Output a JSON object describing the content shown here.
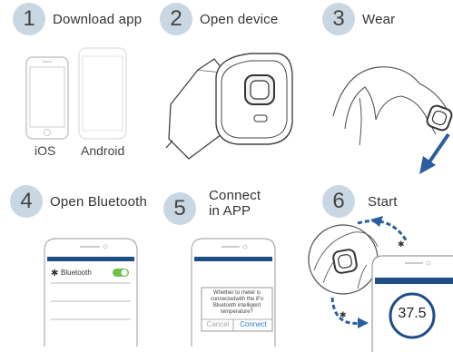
{
  "steps": [
    {
      "number": "1",
      "label": "Download app"
    },
    {
      "number": "2",
      "label": "Open device"
    },
    {
      "number": "3",
      "label": "Wear"
    },
    {
      "number": "4",
      "label": "Open Bluetooth"
    },
    {
      "number": "5",
      "label_line1": "Connect",
      "label_line2": "in APP"
    },
    {
      "number": "6",
      "label": "Start"
    }
  ],
  "download": {
    "ios": "iOS",
    "android": "Android"
  },
  "bluetooth_screen": {
    "setting_label": "Bluetooth"
  },
  "connect_dialog": {
    "line1": "Whether to meter is",
    "line2": "connectedwith the iFo",
    "line3": "Bluetooth intelligent",
    "line4": "temperature?",
    "cancel": "Cancel",
    "connect": "Connect"
  },
  "start_screen": {
    "temperature": "37.5"
  },
  "colors": {
    "badge": "#c9d7e2",
    "app_bar": "#1f4d86",
    "toggle_on": "#6cc24a",
    "arrow": "#2a5ea0"
  }
}
